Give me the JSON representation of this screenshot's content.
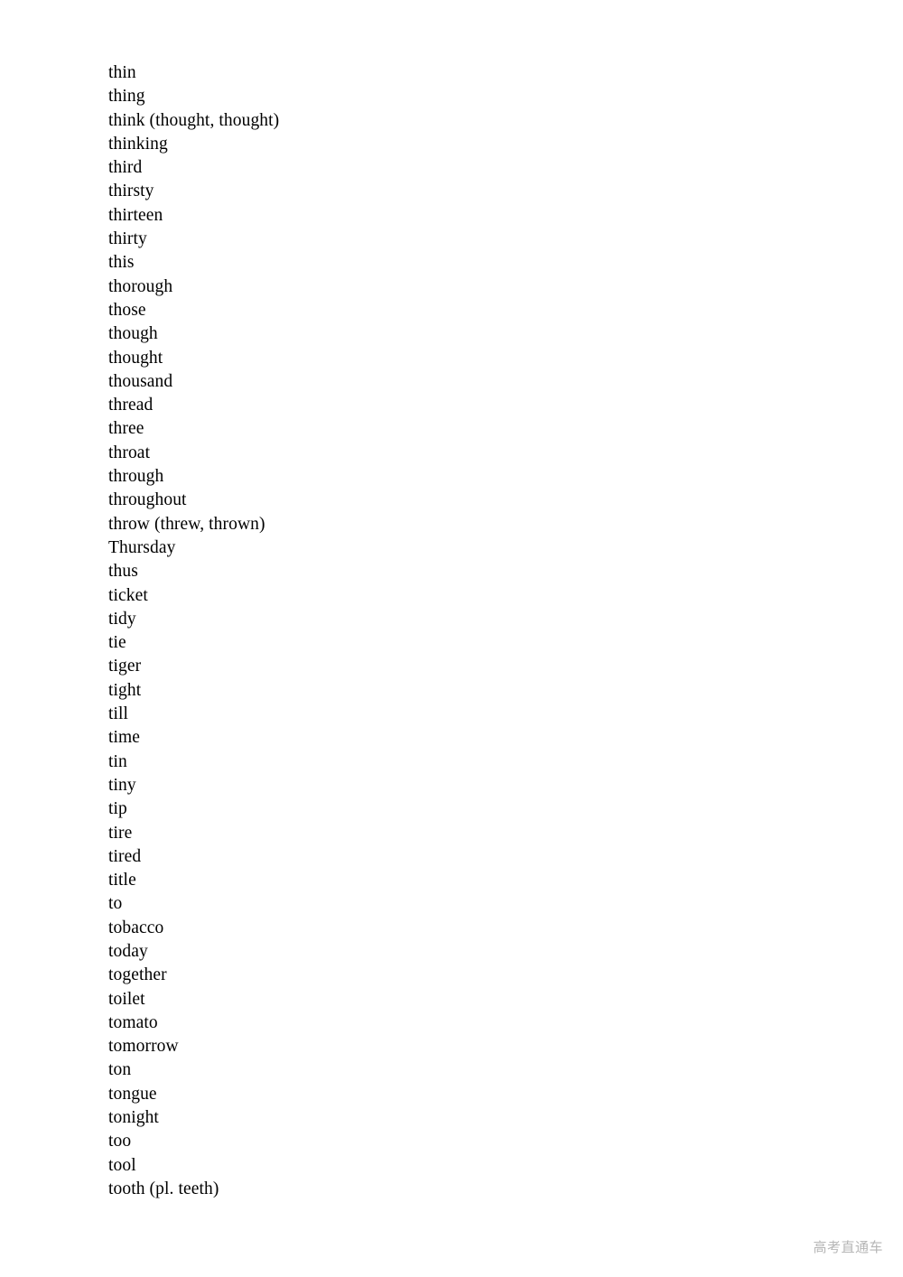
{
  "document": {
    "type": "vocabulary-word-list",
    "background_color": "#ffffff",
    "text_color": "#000000"
  },
  "word_list": {
    "items": [
      {
        "text": "thin"
      },
      {
        "text": "thing"
      },
      {
        "text": "think (thought, thought)"
      },
      {
        "text": "thinking"
      },
      {
        "text": "third"
      },
      {
        "text": "thirsty"
      },
      {
        "text": "thirteen"
      },
      {
        "text": "thirty"
      },
      {
        "text": "this"
      },
      {
        "text": "thorough"
      },
      {
        "text": "those"
      },
      {
        "text": "though"
      },
      {
        "text": "thought"
      },
      {
        "text": "thousand"
      },
      {
        "text": "thread"
      },
      {
        "text": "three"
      },
      {
        "text": "throat"
      },
      {
        "text": "through"
      },
      {
        "text": "throughout"
      },
      {
        "text": "throw (threw, thrown)"
      },
      {
        "text": "Thursday"
      },
      {
        "text": "thus"
      },
      {
        "text": "ticket"
      },
      {
        "text": "tidy"
      },
      {
        "text": "tie"
      },
      {
        "text": "tiger"
      },
      {
        "text": "tight"
      },
      {
        "text": "till"
      },
      {
        "text": "time"
      },
      {
        "text": "tin"
      },
      {
        "text": "tiny"
      },
      {
        "text": "tip"
      },
      {
        "text": "tire"
      },
      {
        "text": "tired"
      },
      {
        "text": "title"
      },
      {
        "text": "to"
      },
      {
        "text": "tobacco"
      },
      {
        "text": "today"
      },
      {
        "text": "together"
      },
      {
        "text": "toilet"
      },
      {
        "text": "tomato"
      },
      {
        "text": "tomorrow"
      },
      {
        "text": "ton"
      },
      {
        "text": "tongue"
      },
      {
        "text": "tonight"
      },
      {
        "text": "too"
      },
      {
        "text": "tool"
      },
      {
        "text": "tooth (pl. teeth)"
      }
    ]
  },
  "watermark": {
    "text": "高考直通车",
    "color": "#b6b6b6"
  }
}
